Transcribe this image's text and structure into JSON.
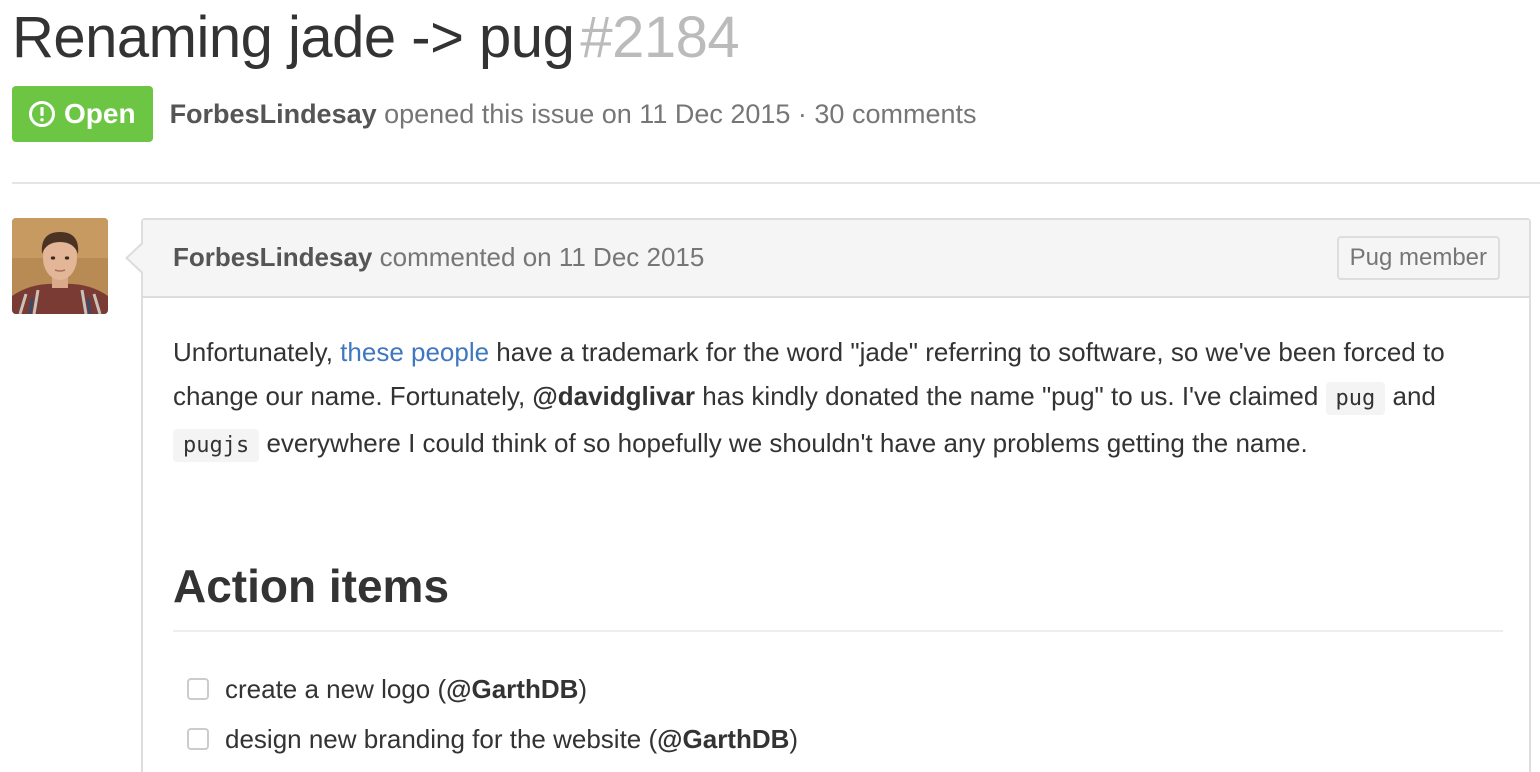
{
  "issue": {
    "title": "Renaming jade -> pug",
    "number": "#2184",
    "state": "Open",
    "state_color": "#6cc644",
    "meta": {
      "author": "ForbesLindesay",
      "opened_text": " opened this issue on 11 Dec 2015 · 30 comments"
    }
  },
  "comment": {
    "author": "ForbesLindesay",
    "commented_text": " commented on 11 Dec 2015",
    "role_label": "Pug member",
    "body": {
      "p1_a": "Unfortunately, ",
      "link_text": "these people",
      "p1_b": " have a trademark for the word \"jade\" referring to software, so we've been forced to change our name. Fortunately, ",
      "mention": "@davidglivar",
      "p1_c": " has kindly donated the name \"pug\" to us. I've claimed ",
      "code1": "pug",
      "p1_d": " and ",
      "code2": "pugjs",
      "p1_e": " everywhere I could think of so hopefully we shouldn't have any problems getting the name."
    },
    "heading": "Action items",
    "tasks": [
      {
        "text": "create a new logo (",
        "mention": "@GarthDB",
        "tail": ")",
        "checked": false
      },
      {
        "text": "design new branding for the website (",
        "mention": "@GarthDB",
        "tail": ")",
        "checked": false
      }
    ]
  },
  "colors": {
    "link": "#4078c0",
    "muted": "#767676",
    "border": "#dddddd"
  },
  "icons": {
    "state": "issue-opened-icon",
    "avatar": "user-avatar"
  }
}
